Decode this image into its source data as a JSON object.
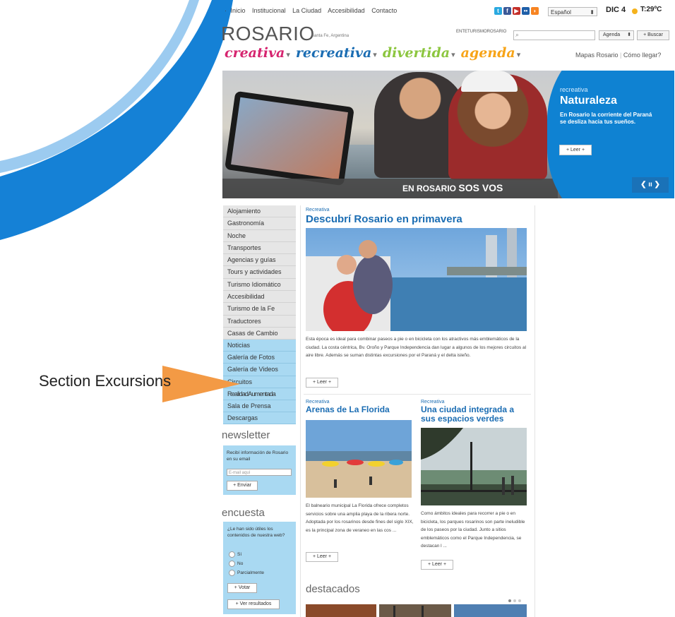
{
  "topnav": {
    "items": [
      "Inicio",
      "Institucional",
      "La Ciudad",
      "Accesibilidad",
      "Contacto"
    ]
  },
  "header": {
    "brand": "ROSARIO",
    "brand_sub": "Santa Fe, Argentina",
    "ente": "ENTETURISMOROSARIO",
    "language": "Español",
    "date": "DIC 4",
    "temp": "T:29ºC",
    "search_placeholder": "",
    "agenda_select": "Agenda",
    "search_button": "+ Buscar"
  },
  "catnav": {
    "items": [
      {
        "label": "creativa",
        "color": "#d6246f"
      },
      {
        "label": "recreativa",
        "color": "#1b6db3"
      },
      {
        "label": "divertida",
        "color": "#8cc63f"
      },
      {
        "label": "agenda",
        "color": "#f7a418"
      }
    ],
    "links": [
      "Mapas Rosario",
      "Cómo llegar?"
    ]
  },
  "hero": {
    "kicker": "recreativa",
    "title": "Naturaleza",
    "description": "En Rosario la corriente del Paraná se desliza hacia tus sueños.",
    "button": "+ Leer +",
    "banner_regular": "EN ROSARIO",
    "banner_bold": "SOS VOS",
    "controls": "❮ ıı ❯"
  },
  "left_menu": {
    "primary": [
      "Alojamiento",
      "Gastronomía",
      "Noche",
      "Transportes",
      "Agencias y guías",
      "Tours y actividades",
      "Turismo Idiomático",
      "Accesibilidad",
      "Turismo de la Fe",
      "Traductores",
      "Casas de Cambio"
    ],
    "secondary": [
      "Noticias",
      "Galería de Fotos",
      "Galería de Videos",
      "Circuitos",
      "RealidadAumentada",
      "Sala de Prensa",
      "Descargas"
    ]
  },
  "newsletter": {
    "heading": "newsletter",
    "text": "Recibí información de Rosario en su email",
    "input_placeholder": "E-mail aquí",
    "button": "+ Enviar"
  },
  "poll": {
    "heading": "encuesta",
    "question": "¿Le han sido útiles los contenidos de nuestra web?",
    "options": [
      "Sí",
      "No",
      "Parcialmente"
    ],
    "vote_button": "+ Votar",
    "results_button": "+ Ver resultados"
  },
  "articles": {
    "main": {
      "kicker": "Recreativa",
      "title": "Descubrí Rosario en primavera",
      "body": "Esta época es ideal para combinar paseos a pie o en bicicleta con los atractivos más emblemáticos de la ciudad. La costa céntrica, Bv. Oroño y Parque Independencia dan lugar a algunos de los mejores circuitos al aire libre. Además se suman distintas excursiones por el Paraná y el delta isleño.",
      "button": "+ Leer +"
    },
    "left": {
      "kicker": "Recreativa",
      "title": "Arenas de La Florida",
      "body": "El balneario municipal La Florida ofrece completos servicios sobre una amplia playa de la ribera norte. Adoptada por los rosarinos desde fines del siglo XIX, es la principal zona de veraneo en las cos ...",
      "button": "+ Leer +"
    },
    "right": {
      "kicker": "Recreativa",
      "title": "Una ciudad integrada a sus espacios verdes",
      "body": "Como ámbitos ideales para recorrer a pie o en bicicleta, los parques rosarinos son parte ineludible de los paseos por la ciudad. Junto a sitios emblemáticos como el Parque Independencia, se destacan l ...",
      "button": "+ Leer +"
    },
    "destacados": "destacados"
  },
  "annotation": {
    "label": "Section Excursions"
  }
}
